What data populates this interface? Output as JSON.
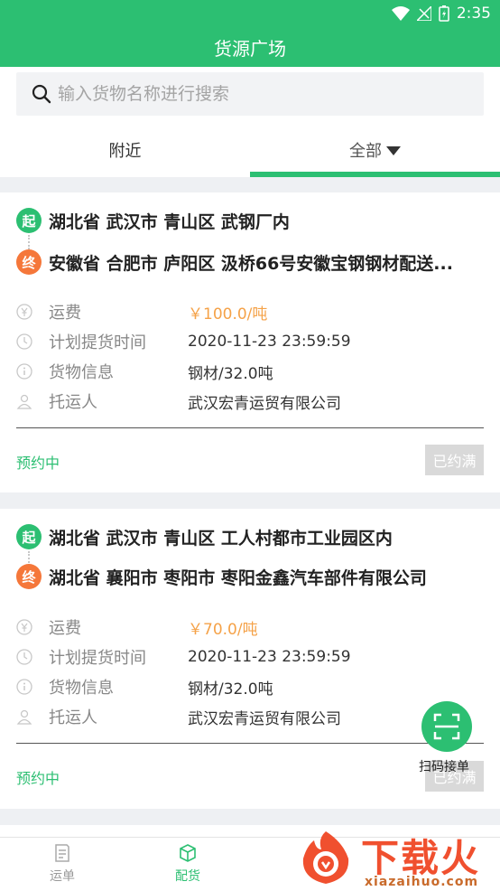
{
  "status_bar": {
    "time": "2:35"
  },
  "app_bar": {
    "title": "货源广场"
  },
  "search": {
    "placeholder": "输入货物名称进行搜索"
  },
  "tabs": [
    {
      "label": "附近"
    },
    {
      "label": "全部"
    }
  ],
  "cards": [
    {
      "start_badge": "起",
      "start": "湖北省 武汉市 青山区 武钢厂内",
      "end_badge": "终",
      "end": "安徽省 合肥市 庐阳区 汲桥66号安徽宝钢钢材配送...",
      "fields": [
        {
          "icon": "yen-icon",
          "label": "运费",
          "value": "￥100.0/吨"
        },
        {
          "icon": "clock-icon",
          "label": "计划提货时间",
          "value": "2020-11-23 23:59:59"
        },
        {
          "icon": "info-icon",
          "label": "货物信息",
          "value": "钢材/32.0吨"
        },
        {
          "icon": "person-icon",
          "label": "托运人",
          "value": "武汉宏青运贸有限公司"
        }
      ],
      "status": "预约中",
      "button": "已约满"
    },
    {
      "start_badge": "起",
      "start": "湖北省 武汉市 青山区 工人村都市工业园区内",
      "end_badge": "终",
      "end": "湖北省 襄阳市 枣阳市 枣阳金鑫汽车部件有限公司",
      "fields": [
        {
          "icon": "yen-icon",
          "label": "运费",
          "value": "￥70.0/吨"
        },
        {
          "icon": "clock-icon",
          "label": "计划提货时间",
          "value": "2020-11-23 23:59:59"
        },
        {
          "icon": "info-icon",
          "label": "货物信息",
          "value": "钢材/32.0吨"
        },
        {
          "icon": "person-icon",
          "label": "托运人",
          "value": "武汉宏青运贸有限公司"
        }
      ],
      "status": "预约中",
      "button": "已约满"
    }
  ],
  "scan": {
    "label": "扫码接单"
  },
  "bottom_nav": [
    {
      "label": "运单",
      "icon": "waybill-icon"
    },
    {
      "label": "配货",
      "icon": "cube-icon"
    }
  ],
  "watermark": {
    "text": "下载火",
    "url": "xiazaihuo.com"
  },
  "colors": {
    "primary": "#2cbf72",
    "price": "#f5a248",
    "end_badge": "#f5773a",
    "disabled": "#d9d9d9"
  }
}
